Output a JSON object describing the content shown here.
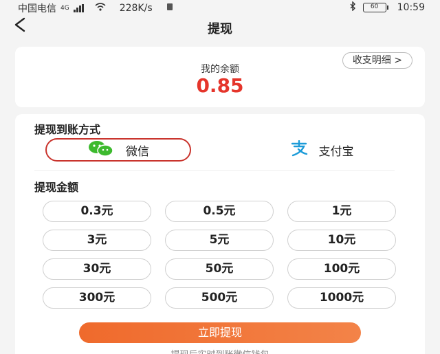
{
  "status_bar": {
    "carrier": "中国电信",
    "network": "4G",
    "speed": "228K/s",
    "battery": "60",
    "time": "10:59"
  },
  "nav": {
    "back_glyph": "<",
    "title": "提现"
  },
  "balance": {
    "detail_label": "收支明细 >",
    "label": "我的余额",
    "value": "0.85"
  },
  "payout_method": {
    "title": "提现到账方式",
    "options": [
      {
        "label": "微信",
        "icon": "wechat-icon",
        "selected": true
      },
      {
        "label": "支付宝",
        "icon": "alipay-icon",
        "selected": false
      }
    ]
  },
  "amount": {
    "title": "提现金额",
    "options": [
      "0.3元",
      "0.5元",
      "1元",
      "3元",
      "5元",
      "10元",
      "30元",
      "50元",
      "100元",
      "300元",
      "500元",
      "1000元"
    ]
  },
  "action": {
    "button_label": "立即提现",
    "note": "提现后实时到账微信钱包"
  },
  "colors": {
    "accent": "#ef6a2c",
    "balance": "#e5352b",
    "wechat": "#3dba2e",
    "alipay": "#1b9bd8"
  }
}
